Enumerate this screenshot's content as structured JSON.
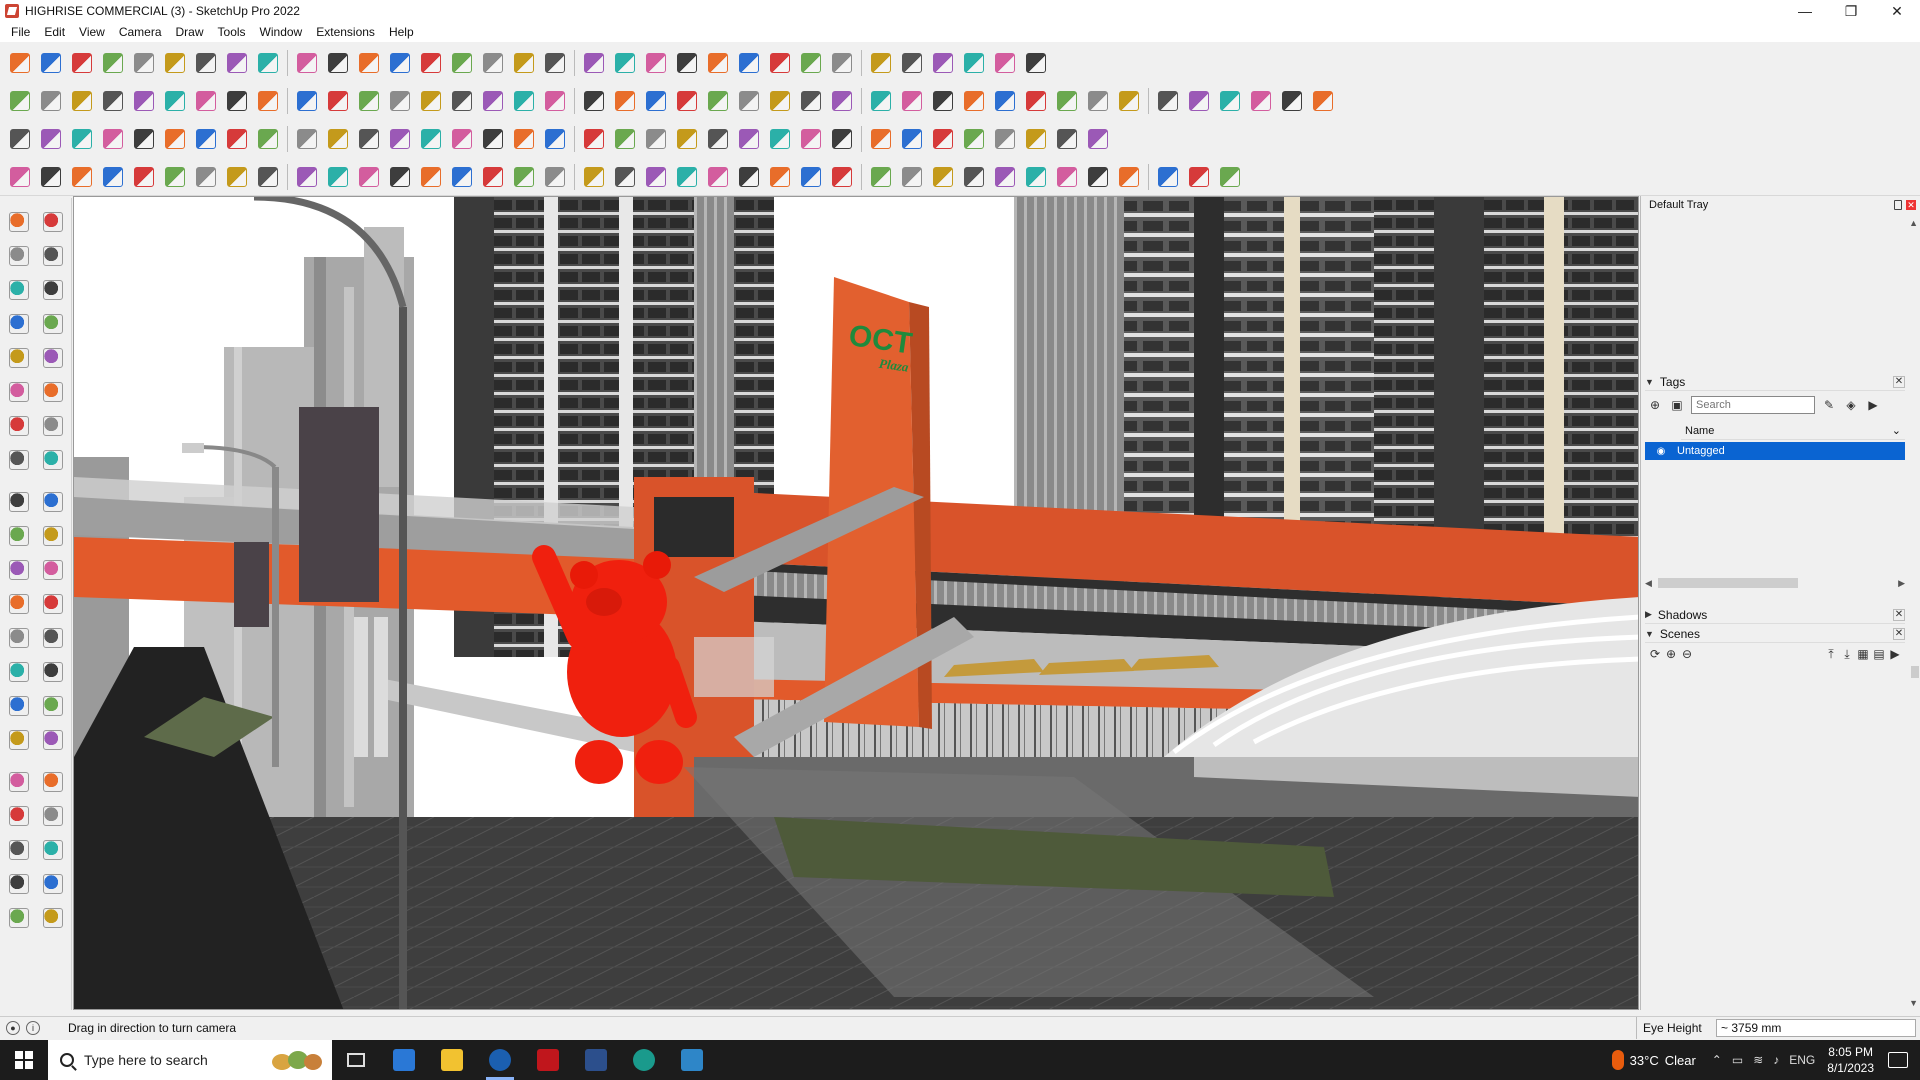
{
  "window": {
    "title": "HIGHRISE COMMERCIAL (3) - SketchUp Pro 2022",
    "controls": {
      "minimize": "—",
      "maximize": "❐",
      "close": "✕"
    }
  },
  "menu": {
    "items": [
      "File",
      "Edit",
      "View",
      "Camera",
      "Draw",
      "Tools",
      "Window",
      "Extensions",
      "Help"
    ]
  },
  "viewport": {
    "sign_line1": "OCT",
    "sign_line2": "Plaza"
  },
  "tray": {
    "title": "Default Tray",
    "tags": {
      "header": "Tags",
      "search_placeholder": "Search",
      "column_name": "Name",
      "rows": [
        {
          "name": "Untagged",
          "selected": true
        }
      ]
    },
    "shadows": {
      "header": "Shadows"
    },
    "scenes": {
      "header": "Scenes"
    }
  },
  "statusbar": {
    "message": "Drag in direction to turn camera",
    "measure_label": "Eye Height",
    "measure_value": "~ 3759 mm"
  },
  "taskbar": {
    "search_placeholder": "Type here to search",
    "weather_temp": "33°C",
    "weather_desc": "Clear",
    "language": "ENG",
    "time": "8:05 PM",
    "date": "8/1/2023"
  },
  "colors": {
    "accent_orange": "#e25a2b",
    "bear_red": "#f0200e",
    "selection_blue": "#0a64d2",
    "sign_green": "#1f8a3c"
  }
}
